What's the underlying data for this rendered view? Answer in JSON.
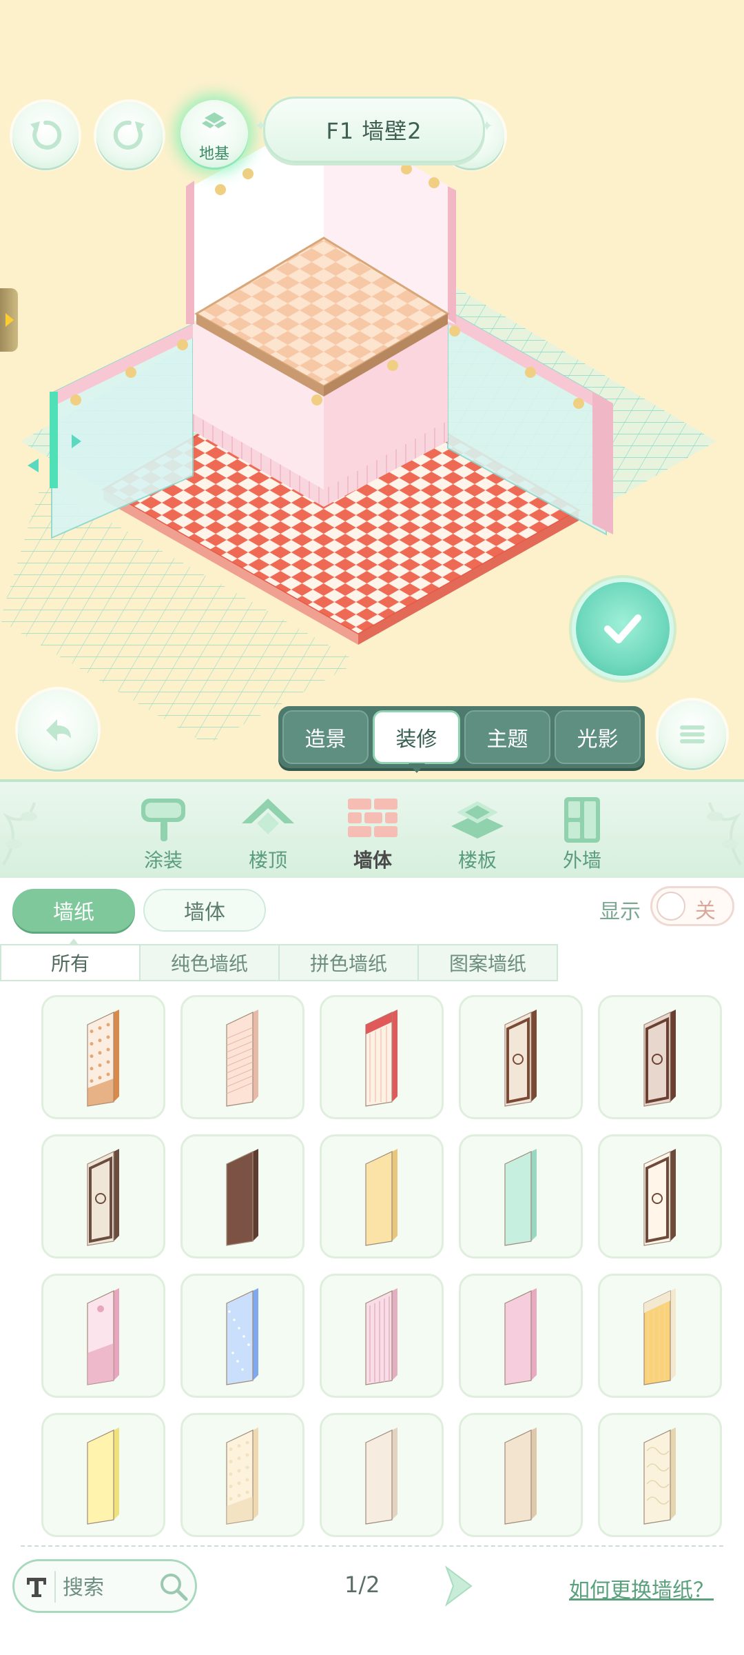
{
  "header": {
    "foundation_label": "地基",
    "floor_title": "F1 墙壁2"
  },
  "mode_tabs": [
    {
      "label": "造景",
      "active": false
    },
    {
      "label": "装修",
      "active": true
    },
    {
      "label": "主题",
      "active": false
    },
    {
      "label": "光影",
      "active": false
    }
  ],
  "categories": [
    {
      "label": "涂装",
      "icon": "paint-roller-icon",
      "active": false
    },
    {
      "label": "楼顶",
      "icon": "roof-icon",
      "active": false
    },
    {
      "label": "墙体",
      "icon": "brick-wall-icon",
      "active": true
    },
    {
      "label": "楼板",
      "icon": "floor-slab-icon",
      "active": false
    },
    {
      "label": "外墙",
      "icon": "exterior-wall-icon",
      "active": false
    }
  ],
  "segments": {
    "wallpaper": "墙纸",
    "wall": "墙体",
    "active": "wallpaper"
  },
  "display_toggle": {
    "label": "显示",
    "state": "关"
  },
  "sub_tabs": [
    {
      "label": "所有",
      "active": true
    },
    {
      "label": "纯色墙纸",
      "active": false
    },
    {
      "label": "拼色墙纸",
      "active": false
    },
    {
      "label": "图案墙纸",
      "active": false
    }
  ],
  "wallpapers": [
    {
      "color": "#fbeee0",
      "accent": "#d98a4a",
      "pattern": "dots"
    },
    {
      "color": "#fde2d6",
      "accent": "#e7b9a6",
      "pattern": "grid"
    },
    {
      "color": "#fdf1e3",
      "accent": "#e05a5a",
      "pattern": "stripe-top"
    },
    {
      "color": "#f2e6d8",
      "accent": "#7a4a35",
      "pattern": "frame"
    },
    {
      "color": "#e8d7cc",
      "accent": "#6b4032",
      "pattern": "frame"
    },
    {
      "color": "#efe6d8",
      "accent": "#6a4d3e",
      "pattern": "frame"
    },
    {
      "color": "#7b5243",
      "accent": "#5e3d31",
      "pattern": "plain"
    },
    {
      "color": "#fbe3a8",
      "accent": "#e8c77c",
      "pattern": "plain"
    },
    {
      "color": "#c6efe0",
      "accent": "#98d8c2",
      "pattern": "plain"
    },
    {
      "color": "#fff5e8",
      "accent": "#6d4a3a",
      "pattern": "frame"
    },
    {
      "color": "#fbe4ec",
      "accent": "#e7a6bd",
      "pattern": "bow"
    },
    {
      "color": "#c9dffb",
      "accent": "#7fa9ec",
      "pattern": "stars"
    },
    {
      "color": "#f9dde6",
      "accent": "#e2b0c1",
      "pattern": "stripes"
    },
    {
      "color": "#f6cddd",
      "accent": "#e9a9c0",
      "pattern": "plain"
    },
    {
      "color": "#f9d27a",
      "accent": "#f3e9d0",
      "pattern": "stripe-top"
    },
    {
      "color": "#fff3ad",
      "accent": "#f0e27a",
      "pattern": "plain"
    },
    {
      "color": "#fdf3dc",
      "accent": "#eed9b2",
      "pattern": "dots"
    },
    {
      "color": "#f7ece0",
      "accent": "#e4d3c2",
      "pattern": "plain"
    },
    {
      "color": "#f3e4cf",
      "accent": "#dfc9ab",
      "pattern": "plain"
    },
    {
      "color": "#fbf2dd",
      "accent": "#e6d6b0",
      "pattern": "swirl"
    }
  ],
  "search": {
    "placeholder": "搜索"
  },
  "pagination": {
    "current": 1,
    "total": 2,
    "text": "1/2"
  },
  "help_link": "如何更换墙纸？"
}
